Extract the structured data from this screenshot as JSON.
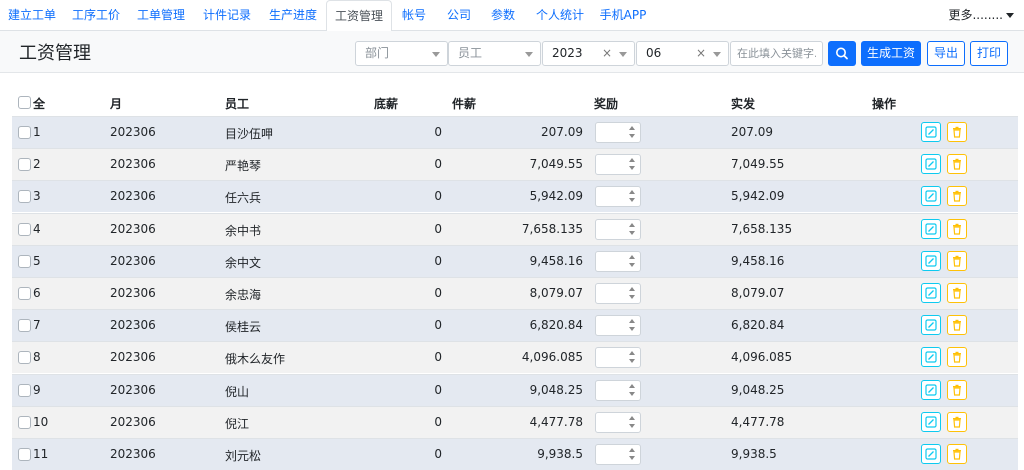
{
  "nav": {
    "tabs": [
      "建立工单",
      "工序工价",
      "工单管理",
      "计件记录",
      "生产进度",
      "工资管理",
      "帐号",
      "公司",
      "参数",
      "个人统计",
      "手机APP"
    ],
    "active_index": 5,
    "more": "更多........"
  },
  "header": {
    "title": "工资管理",
    "dept_placeholder": "部门",
    "employee_placeholder": "员工",
    "year": "2023",
    "month": "06",
    "keyword_placeholder": "在此填入关键字.",
    "generate_label": "生成工资",
    "export_label": "导出",
    "print_label": "打印"
  },
  "table": {
    "columns": [
      "全",
      "月",
      "员工",
      "底薪",
      "件薪",
      "奖励",
      "实发",
      "操作"
    ],
    "rows": [
      {
        "no": "1",
        "month": "202306",
        "employee": "目沙伍呷",
        "base": "0",
        "piece": "207.09",
        "actual": "207.09"
      },
      {
        "no": "2",
        "month": "202306",
        "employee": "严艳琴",
        "base": "0",
        "piece": "7,049.55",
        "actual": "7,049.55"
      },
      {
        "no": "3",
        "month": "202306",
        "employee": "任六兵",
        "base": "0",
        "piece": "5,942.09",
        "actual": "5,942.09"
      },
      {
        "no": "4",
        "month": "202306",
        "employee": "余中书",
        "base": "0",
        "piece": "7,658.135",
        "actual": "7,658.135"
      },
      {
        "no": "5",
        "month": "202306",
        "employee": "余中文",
        "base": "0",
        "piece": "9,458.16",
        "actual": "9,458.16"
      },
      {
        "no": "6",
        "month": "202306",
        "employee": "余忠海",
        "base": "0",
        "piece": "8,079.07",
        "actual": "8,079.07"
      },
      {
        "no": "7",
        "month": "202306",
        "employee": "侯桂云",
        "base": "0",
        "piece": "6,820.84",
        "actual": "6,820.84"
      },
      {
        "no": "8",
        "month": "202306",
        "employee": "俄木么友作",
        "base": "0",
        "piece": "4,096.085",
        "actual": "4,096.085"
      },
      {
        "no": "9",
        "month": "202306",
        "employee": "倪山",
        "base": "0",
        "piece": "9,048.25",
        "actual": "9,048.25"
      },
      {
        "no": "10",
        "month": "202306",
        "employee": "倪江",
        "base": "0",
        "piece": "4,477.78",
        "actual": "4,477.78"
      },
      {
        "no": "11",
        "month": "202306",
        "employee": "刘元松",
        "base": "0",
        "piece": "9,938.5",
        "actual": "9,938.5"
      }
    ]
  },
  "icons": {
    "search": "search-icon",
    "edit": "edit-icon",
    "delete": "trash-icon"
  },
  "colors": {
    "primary": "#0d6efd",
    "edit": "#0dcaf0",
    "delete": "#ffc107",
    "row_odd": "#e4e9f1",
    "row_even": "#f2f2f2"
  }
}
